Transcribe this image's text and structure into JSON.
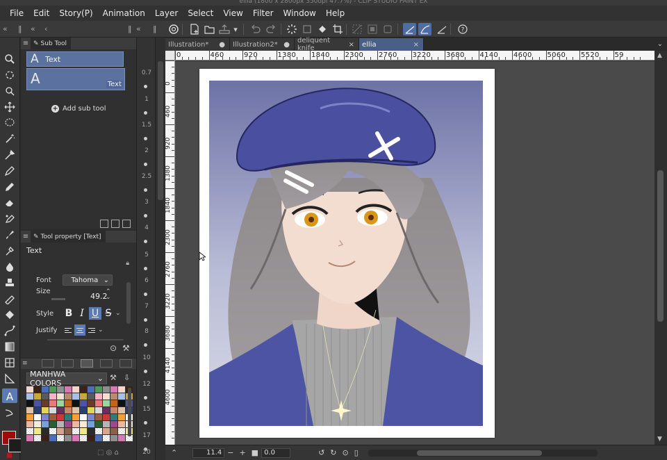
{
  "titlebar": {
    "text": "ellia (1800 x 2800px 350dpi 47.7%) - CLIP STUDIO PAINT EX"
  },
  "menu": [
    "File",
    "Edit",
    "Story(P)",
    "Animation",
    "Layer",
    "Select",
    "View",
    "Filter",
    "Window",
    "Help"
  ],
  "subtool_panel": {
    "tab_label": "Sub Tool",
    "items": [
      {
        "label": "Text",
        "icon": "text-a-icon"
      },
      {
        "label": "Text",
        "icon": "text-a-icon"
      }
    ],
    "add_label": "Add sub tool"
  },
  "toolprop_panel": {
    "tab_label": "Tool property [Text]",
    "title": "Text",
    "font_label": "Font",
    "font_value": "Tahoma",
    "size_label": "Size",
    "size_value": "49.2",
    "style_label": "Style",
    "style_buttons": [
      "B",
      "I",
      "U",
      "S"
    ],
    "justify_label": "Justify"
  },
  "colorset_panel": {
    "set_name": "MANHWA COLORS"
  },
  "doc_tabs": [
    {
      "label": "Illustration*",
      "active": false,
      "close": "●"
    },
    {
      "label": "Illustration2*",
      "active": false,
      "close": "●"
    },
    {
      "label": "deliquent knife",
      "active": false,
      "close": "×"
    },
    {
      "label": "ellia",
      "active": true,
      "close": "×"
    }
  ],
  "ruler_top_labels": [
    "0",
    "460",
    "920",
    "1380",
    "1840",
    "2300",
    "2760",
    "3220",
    "3680",
    "4140",
    "4600",
    "5060",
    "5520",
    "59"
  ],
  "ruler_left_labels": [
    "0",
    "460",
    "920",
    "1380",
    "1840",
    "2300",
    "2760",
    "3220",
    "3680",
    "4140",
    "4600"
  ],
  "nav_labels": [
    "0.7",
    "1",
    "1.5",
    "2",
    "2.5",
    "3",
    "4",
    "5",
    "6",
    "7",
    "8",
    "10",
    "12",
    "15",
    "17",
    "20"
  ],
  "statusbar": {
    "zoom": "11.4",
    "minus": "−",
    "plus": "+",
    "angle": "0.0"
  },
  "colors": {
    "accent": "#5a7bb5",
    "main_color": "#a00a0a",
    "sub_color": "#1d1d1d"
  }
}
